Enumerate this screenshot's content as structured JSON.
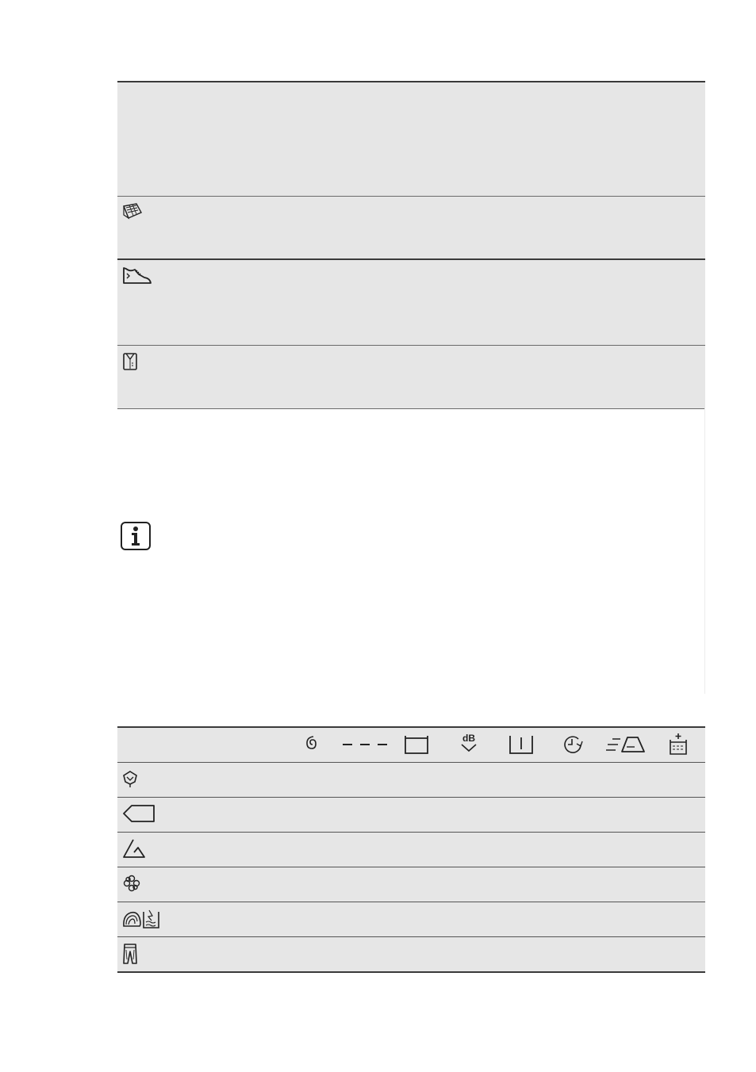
{
  "upper_table": {
    "rows": [
      {
        "icon": "blank"
      },
      {
        "icon": "curtains-icon"
      },
      {
        "icon": "sportswear-icon"
      },
      {
        "icon": "shirt-icon"
      }
    ]
  },
  "info": {
    "icon": "info-icon"
  },
  "options_table": {
    "header_icons": [
      "spin-icon",
      "no-spin-icon",
      "rinse-hold-icon",
      "night-cycle-icon",
      "prewash-icon",
      "time-save-icon",
      "easy-iron-icon",
      "extra-rinse-icon"
    ],
    "programme_icons": [
      "eco-cotton-icon",
      "synthetics-icon",
      "delicates-icon",
      "refresh-icon",
      "wool-silk-icon",
      "denim-icon"
    ]
  }
}
